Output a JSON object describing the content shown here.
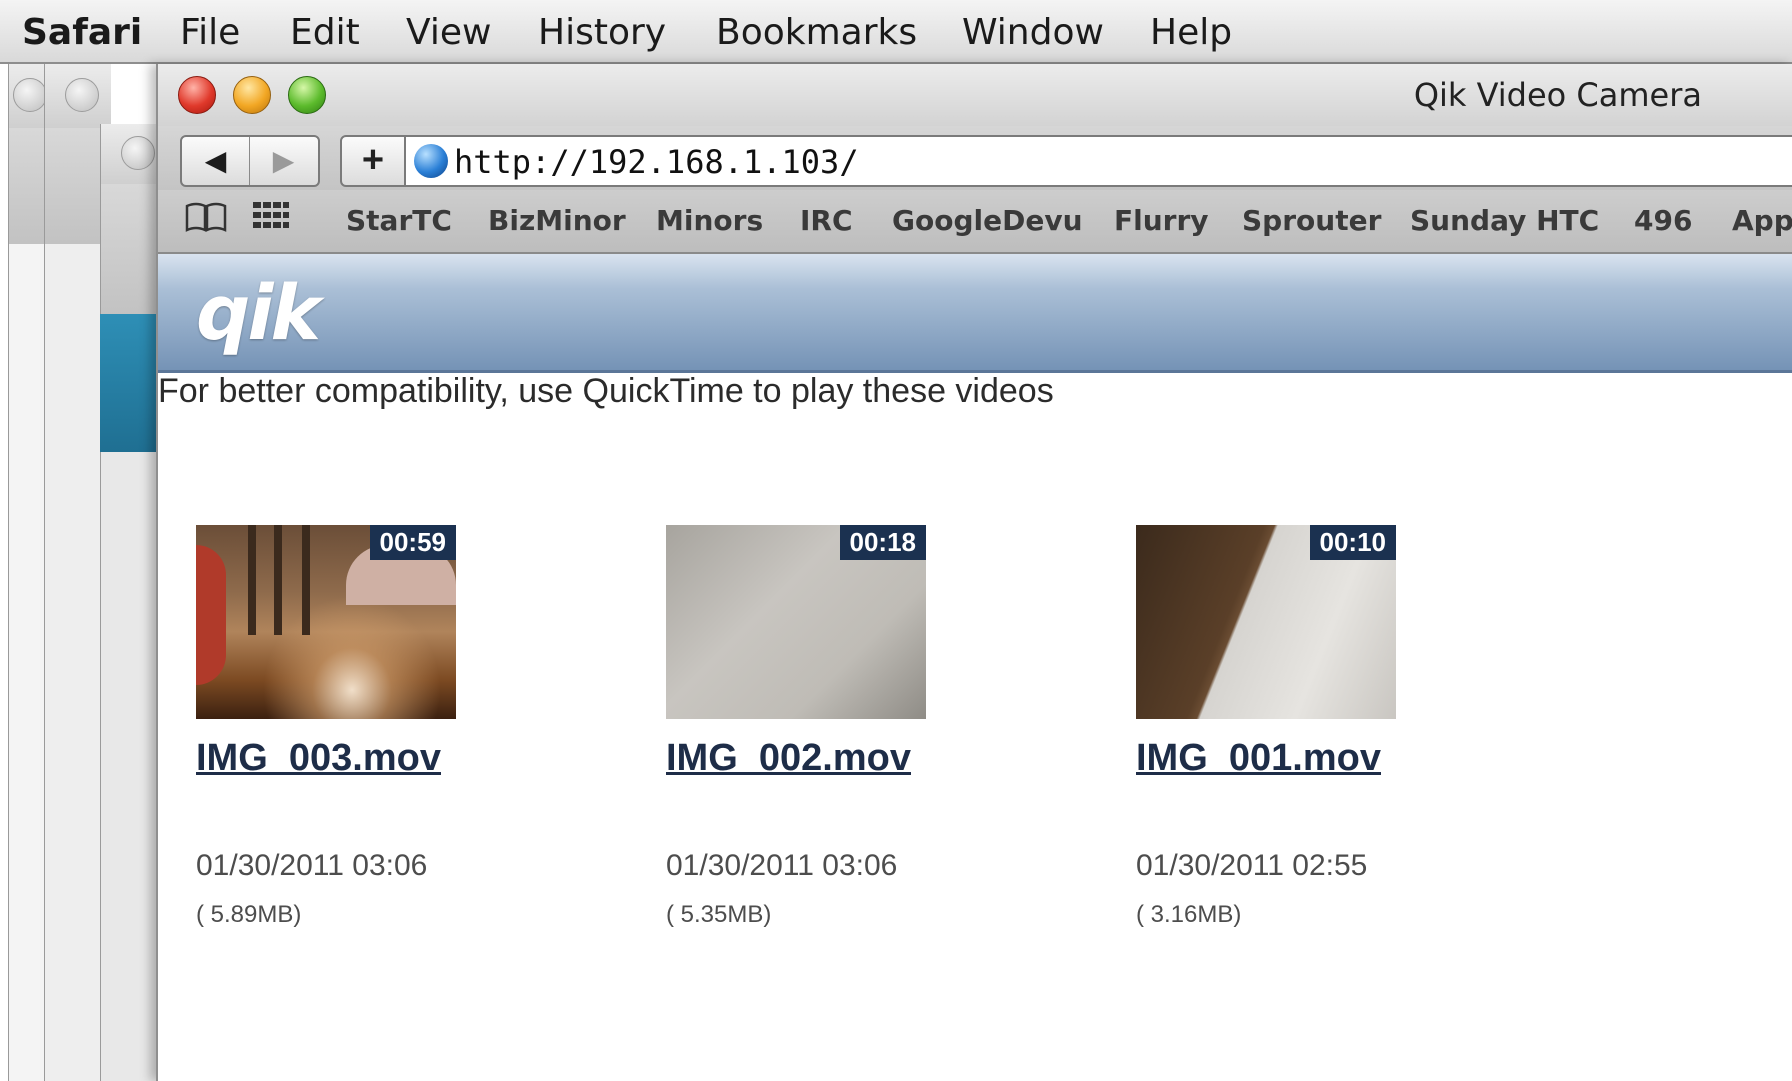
{
  "menubar": {
    "app": "Safari",
    "items": [
      "File",
      "Edit",
      "View",
      "History",
      "Bookmarks",
      "Window",
      "Help"
    ]
  },
  "window": {
    "title": "Qik Video Camera",
    "url": "http://192.168.1.103/",
    "back_label": "◀",
    "forward_label": "▶",
    "add_label": "+"
  },
  "bookmarks": [
    "StarTC",
    "BizMinor",
    "Minors",
    "IRC",
    "GoogleDevu",
    "Flurry",
    "Sprouter",
    "Sunday HTC",
    "496",
    "App"
  ],
  "page": {
    "logo": "qik",
    "notice": "For better compatibility, use QuickTime to play these videos",
    "videos": [
      {
        "name": "IMG_003.mov",
        "duration": "00:59",
        "date": "01/30/2011 03:06",
        "size": "( 5.89MB)"
      },
      {
        "name": "IMG_002.mov",
        "duration": "00:18",
        "date": "01/30/2011 03:06",
        "size": "( 5.35MB)"
      },
      {
        "name": "IMG_001.mov",
        "duration": "00:10",
        "date": "01/30/2011 02:55",
        "size": "( 3.16MB)"
      }
    ]
  },
  "colors": {
    "banner_top": "#d9e3ef",
    "banner_bottom": "#7593b6",
    "duration_badge": "#1b3150",
    "link": "#1e2d48"
  }
}
